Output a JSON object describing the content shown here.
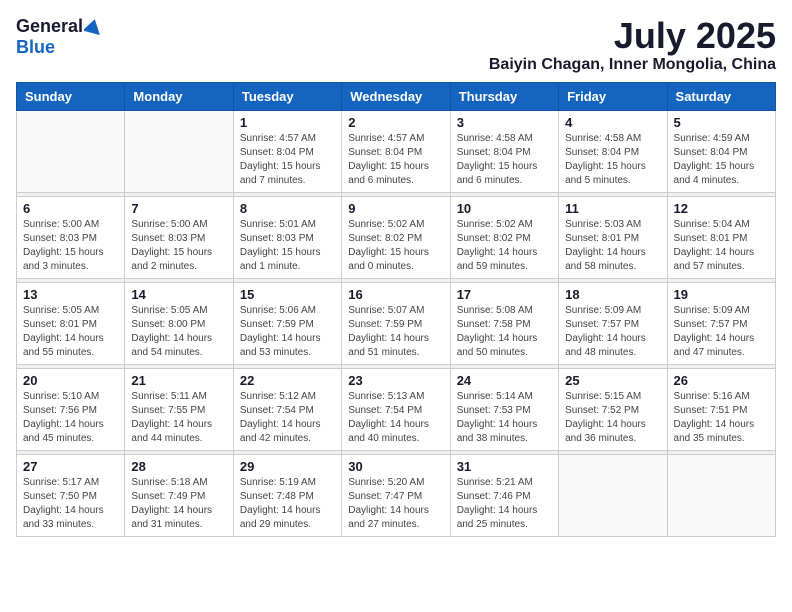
{
  "header": {
    "logo_general": "General",
    "logo_blue": "Blue",
    "month": "July 2025",
    "location": "Baiyin Chagan, Inner Mongolia, China"
  },
  "weekdays": [
    "Sunday",
    "Monday",
    "Tuesday",
    "Wednesday",
    "Thursday",
    "Friday",
    "Saturday"
  ],
  "weeks": [
    [
      {
        "day": "",
        "info": ""
      },
      {
        "day": "",
        "info": ""
      },
      {
        "day": "1",
        "info": "Sunrise: 4:57 AM\nSunset: 8:04 PM\nDaylight: 15 hours and 7 minutes."
      },
      {
        "day": "2",
        "info": "Sunrise: 4:57 AM\nSunset: 8:04 PM\nDaylight: 15 hours and 6 minutes."
      },
      {
        "day": "3",
        "info": "Sunrise: 4:58 AM\nSunset: 8:04 PM\nDaylight: 15 hours and 6 minutes."
      },
      {
        "day": "4",
        "info": "Sunrise: 4:58 AM\nSunset: 8:04 PM\nDaylight: 15 hours and 5 minutes."
      },
      {
        "day": "5",
        "info": "Sunrise: 4:59 AM\nSunset: 8:04 PM\nDaylight: 15 hours and 4 minutes."
      }
    ],
    [
      {
        "day": "6",
        "info": "Sunrise: 5:00 AM\nSunset: 8:03 PM\nDaylight: 15 hours and 3 minutes."
      },
      {
        "day": "7",
        "info": "Sunrise: 5:00 AM\nSunset: 8:03 PM\nDaylight: 15 hours and 2 minutes."
      },
      {
        "day": "8",
        "info": "Sunrise: 5:01 AM\nSunset: 8:03 PM\nDaylight: 15 hours and 1 minute."
      },
      {
        "day": "9",
        "info": "Sunrise: 5:02 AM\nSunset: 8:02 PM\nDaylight: 15 hours and 0 minutes."
      },
      {
        "day": "10",
        "info": "Sunrise: 5:02 AM\nSunset: 8:02 PM\nDaylight: 14 hours and 59 minutes."
      },
      {
        "day": "11",
        "info": "Sunrise: 5:03 AM\nSunset: 8:01 PM\nDaylight: 14 hours and 58 minutes."
      },
      {
        "day": "12",
        "info": "Sunrise: 5:04 AM\nSunset: 8:01 PM\nDaylight: 14 hours and 57 minutes."
      }
    ],
    [
      {
        "day": "13",
        "info": "Sunrise: 5:05 AM\nSunset: 8:01 PM\nDaylight: 14 hours and 55 minutes."
      },
      {
        "day": "14",
        "info": "Sunrise: 5:05 AM\nSunset: 8:00 PM\nDaylight: 14 hours and 54 minutes."
      },
      {
        "day": "15",
        "info": "Sunrise: 5:06 AM\nSunset: 7:59 PM\nDaylight: 14 hours and 53 minutes."
      },
      {
        "day": "16",
        "info": "Sunrise: 5:07 AM\nSunset: 7:59 PM\nDaylight: 14 hours and 51 minutes."
      },
      {
        "day": "17",
        "info": "Sunrise: 5:08 AM\nSunset: 7:58 PM\nDaylight: 14 hours and 50 minutes."
      },
      {
        "day": "18",
        "info": "Sunrise: 5:09 AM\nSunset: 7:57 PM\nDaylight: 14 hours and 48 minutes."
      },
      {
        "day": "19",
        "info": "Sunrise: 5:09 AM\nSunset: 7:57 PM\nDaylight: 14 hours and 47 minutes."
      }
    ],
    [
      {
        "day": "20",
        "info": "Sunrise: 5:10 AM\nSunset: 7:56 PM\nDaylight: 14 hours and 45 minutes."
      },
      {
        "day": "21",
        "info": "Sunrise: 5:11 AM\nSunset: 7:55 PM\nDaylight: 14 hours and 44 minutes."
      },
      {
        "day": "22",
        "info": "Sunrise: 5:12 AM\nSunset: 7:54 PM\nDaylight: 14 hours and 42 minutes."
      },
      {
        "day": "23",
        "info": "Sunrise: 5:13 AM\nSunset: 7:54 PM\nDaylight: 14 hours and 40 minutes."
      },
      {
        "day": "24",
        "info": "Sunrise: 5:14 AM\nSunset: 7:53 PM\nDaylight: 14 hours and 38 minutes."
      },
      {
        "day": "25",
        "info": "Sunrise: 5:15 AM\nSunset: 7:52 PM\nDaylight: 14 hours and 36 minutes."
      },
      {
        "day": "26",
        "info": "Sunrise: 5:16 AM\nSunset: 7:51 PM\nDaylight: 14 hours and 35 minutes."
      }
    ],
    [
      {
        "day": "27",
        "info": "Sunrise: 5:17 AM\nSunset: 7:50 PM\nDaylight: 14 hours and 33 minutes."
      },
      {
        "day": "28",
        "info": "Sunrise: 5:18 AM\nSunset: 7:49 PM\nDaylight: 14 hours and 31 minutes."
      },
      {
        "day": "29",
        "info": "Sunrise: 5:19 AM\nSunset: 7:48 PM\nDaylight: 14 hours and 29 minutes."
      },
      {
        "day": "30",
        "info": "Sunrise: 5:20 AM\nSunset: 7:47 PM\nDaylight: 14 hours and 27 minutes."
      },
      {
        "day": "31",
        "info": "Sunrise: 5:21 AM\nSunset: 7:46 PM\nDaylight: 14 hours and 25 minutes."
      },
      {
        "day": "",
        "info": ""
      },
      {
        "day": "",
        "info": ""
      }
    ]
  ]
}
